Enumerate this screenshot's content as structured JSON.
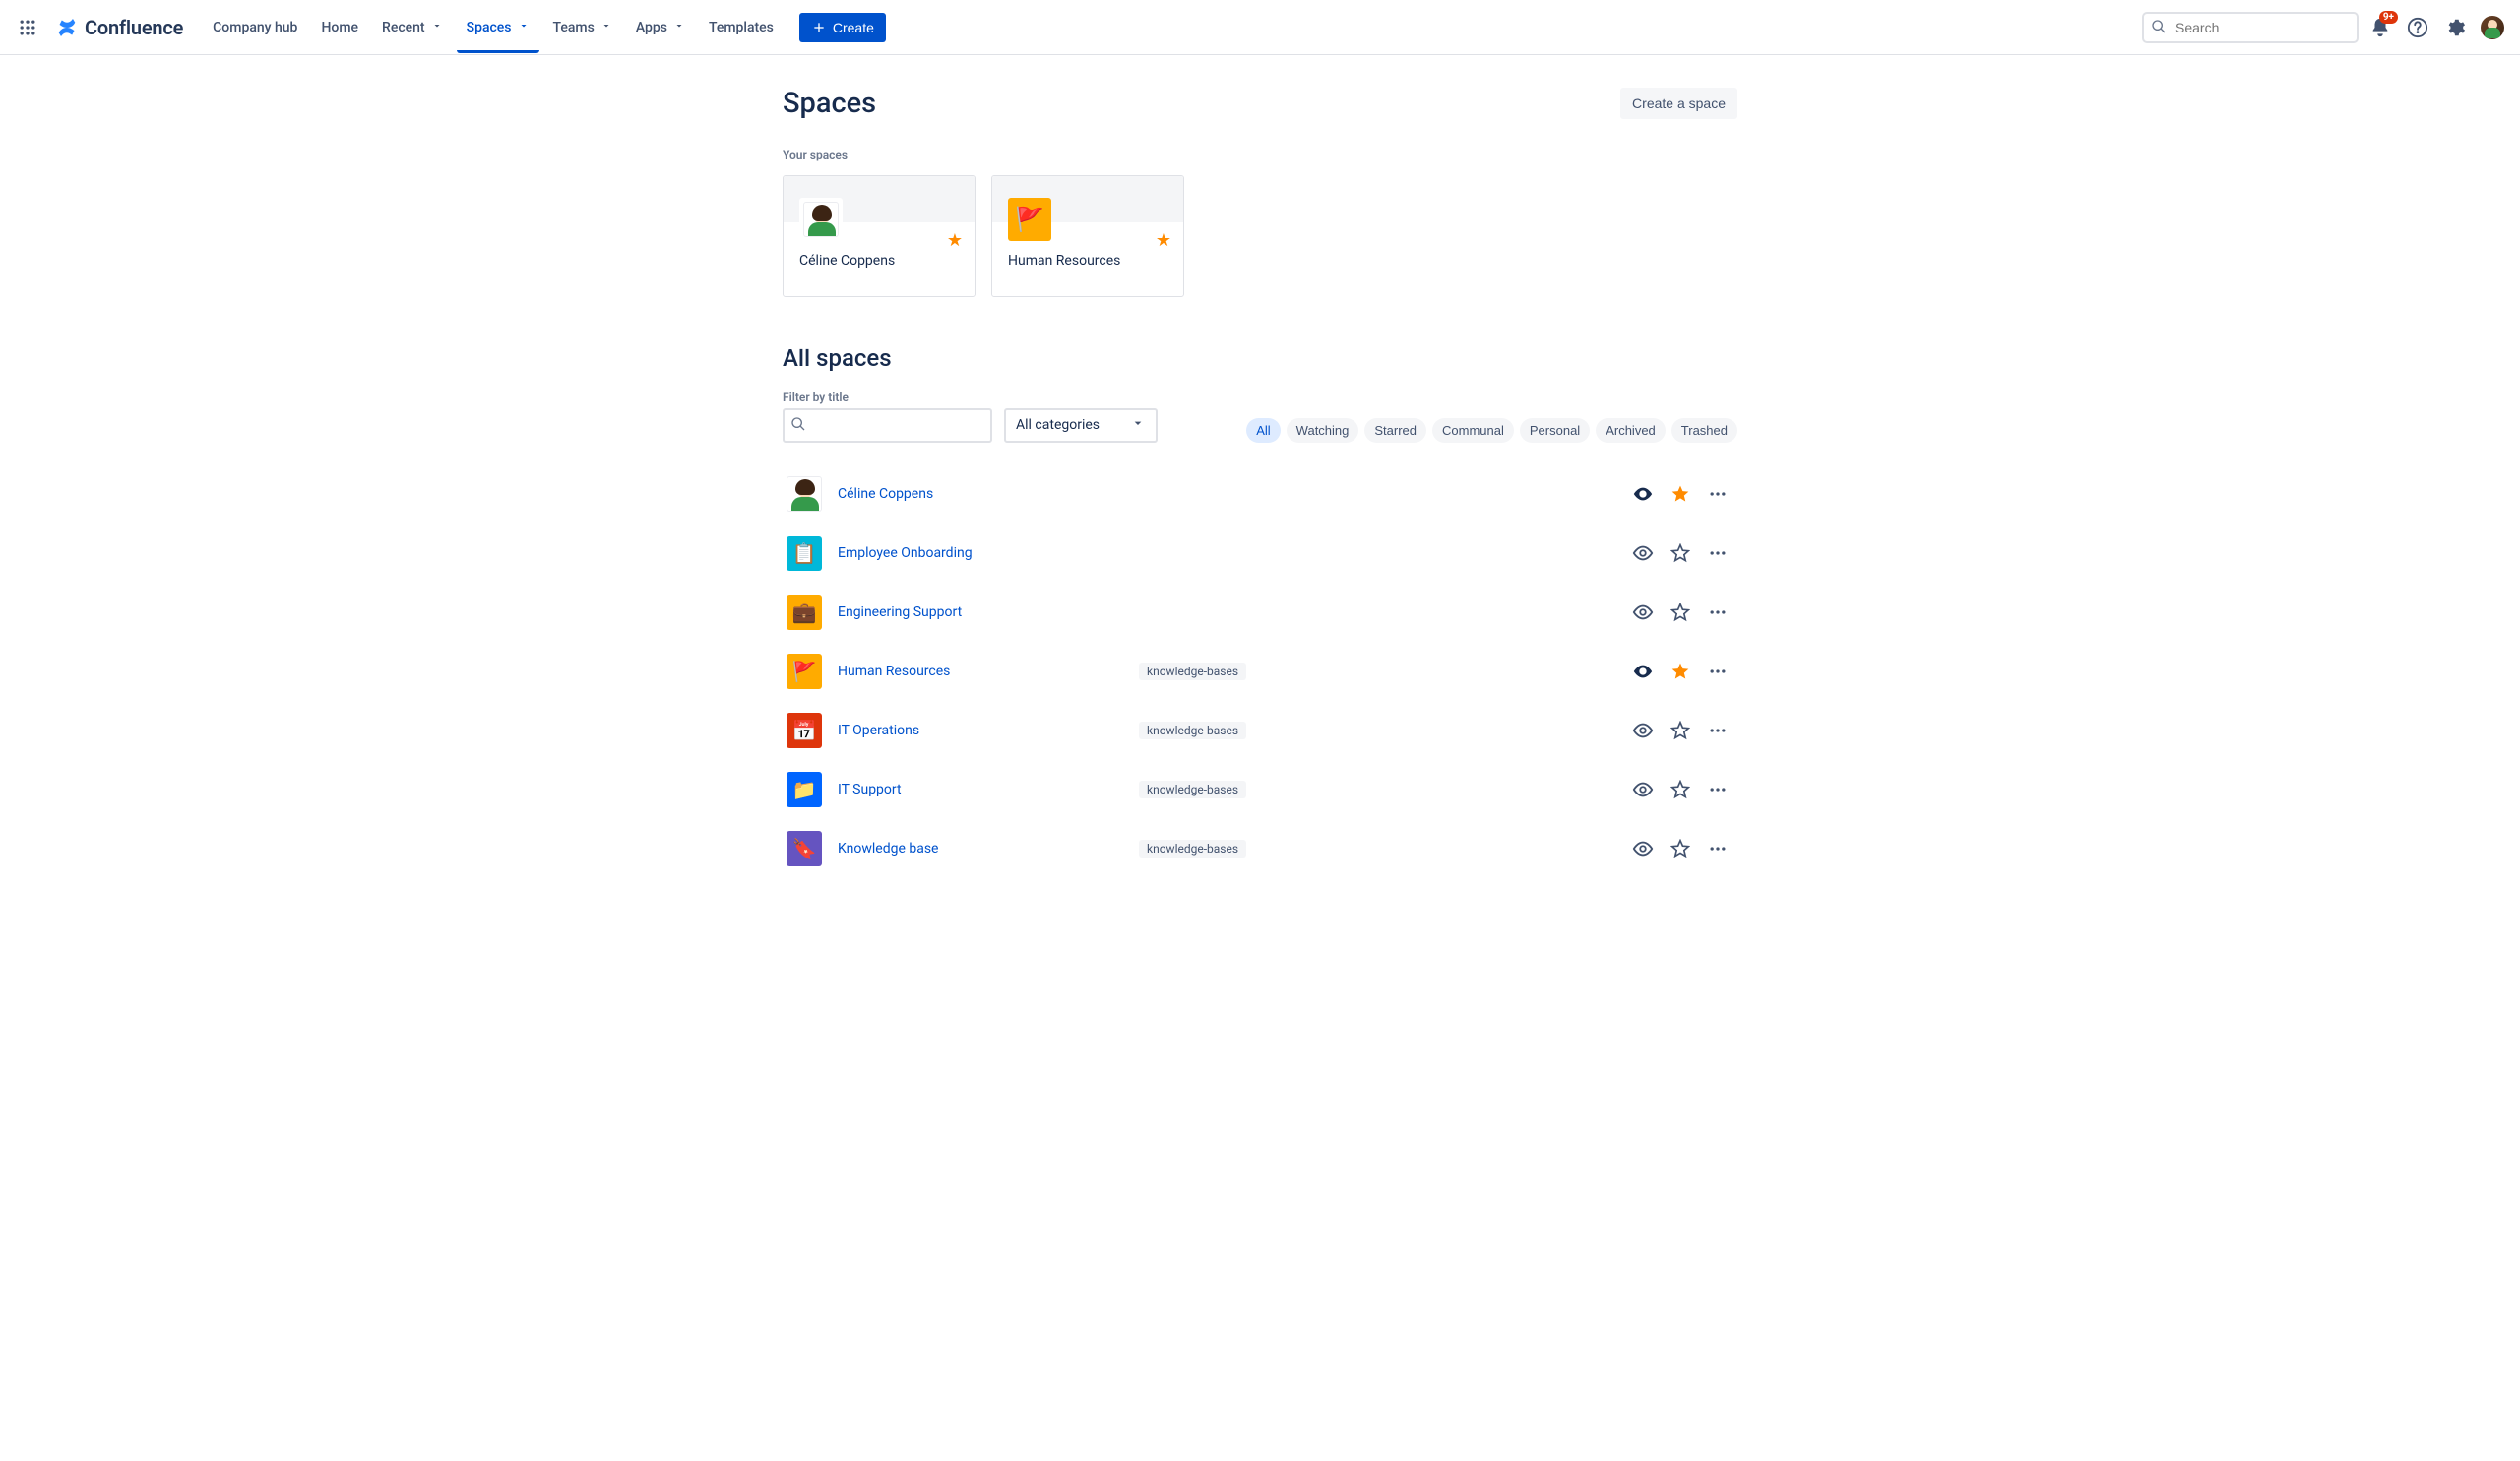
{
  "nav": {
    "product": "Confluence",
    "items": [
      {
        "label": "Company hub",
        "dropdown": false,
        "active": false
      },
      {
        "label": "Home",
        "dropdown": false,
        "active": false
      },
      {
        "label": "Recent",
        "dropdown": true,
        "active": false
      },
      {
        "label": "Spaces",
        "dropdown": true,
        "active": true
      },
      {
        "label": "Teams",
        "dropdown": true,
        "active": false
      },
      {
        "label": "Apps",
        "dropdown": true,
        "active": false
      },
      {
        "label": "Templates",
        "dropdown": false,
        "active": false
      }
    ],
    "create_label": "Create",
    "search_placeholder": "Search",
    "notification_badge": "9+"
  },
  "page": {
    "title": "Spaces",
    "create_space_label": "Create a space"
  },
  "your_spaces": {
    "heading": "Your spaces",
    "cards": [
      {
        "name": "Céline Coppens",
        "icon": "person"
      },
      {
        "name": "Human Resources",
        "icon": "flag"
      }
    ]
  },
  "all_spaces": {
    "heading": "All spaces",
    "filter_label": "Filter by title",
    "category_label": "All categories",
    "pills": [
      "All",
      "Watching",
      "Starred",
      "Communal",
      "Personal",
      "Archived",
      "Trashed"
    ],
    "active_pill": "All",
    "rows": [
      {
        "name": "Céline Coppens",
        "icon": "person",
        "icon_bg": "#FFFFFF",
        "tag": "",
        "watching": true,
        "starred": true
      },
      {
        "name": "Employee Onboarding",
        "icon": "📋",
        "icon_bg": "#00B8D9",
        "tag": "",
        "watching": false,
        "starred": false
      },
      {
        "name": "Engineering Support",
        "icon": "💼",
        "icon_bg": "#FFAB00",
        "tag": "",
        "watching": false,
        "starred": false
      },
      {
        "name": "Human Resources",
        "icon": "🚩",
        "icon_bg": "#FFAB00",
        "tag": "knowledge-bases",
        "watching": true,
        "starred": true
      },
      {
        "name": "IT Operations",
        "icon": "📅",
        "icon_bg": "#DE350B",
        "tag": "knowledge-bases",
        "watching": false,
        "starred": false
      },
      {
        "name": "IT Support",
        "icon": "📁",
        "icon_bg": "#0065FF",
        "tag": "knowledge-bases",
        "watching": false,
        "starred": false
      },
      {
        "name": "Knowledge base",
        "icon": "🔖",
        "icon_bg": "#6554C0",
        "tag": "knowledge-bases",
        "watching": false,
        "starred": false
      }
    ]
  }
}
